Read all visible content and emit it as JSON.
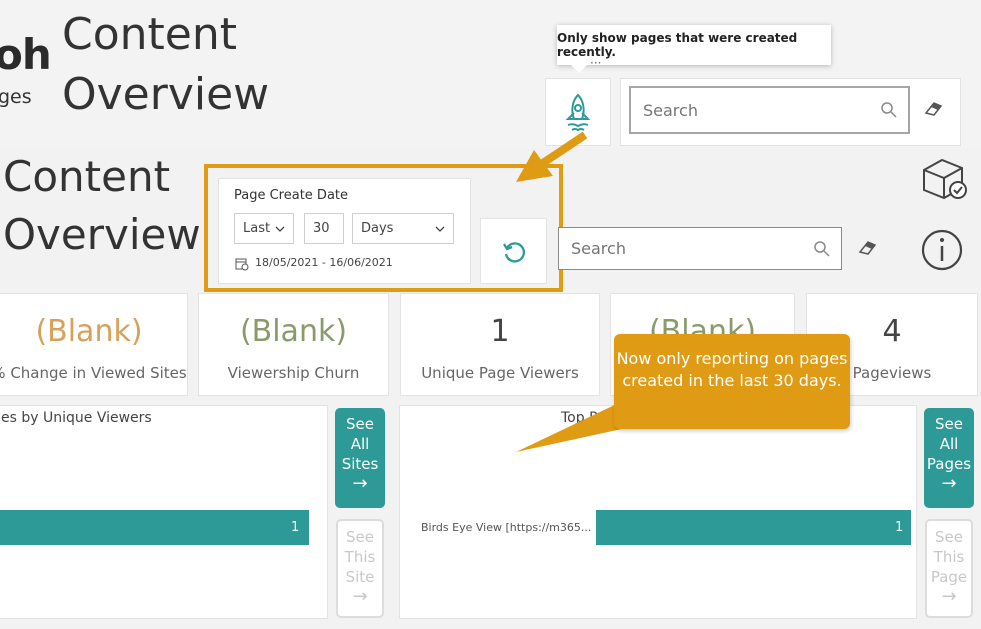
{
  "header": {
    "logo_big": "oh",
    "logo_small": "ges",
    "title_line1": "Content",
    "title_line2": "Overview",
    "tooltip": "Only show pages that were created recently.",
    "search_placeholder": "Search"
  },
  "report": {
    "title_line1": "Content",
    "title_line2": "Overview",
    "search_placeholder": "Search",
    "filter": {
      "label": "Page Create Date",
      "period": "Last",
      "count": "30",
      "unit": "Days",
      "range": "18/05/2021 - 16/06/2021"
    }
  },
  "kpis": [
    {
      "value": "(Blank)",
      "label": "% Change in Viewed Sites"
    },
    {
      "value": "(Blank)",
      "label": "Viewership Churn"
    },
    {
      "value": "1",
      "label": "Unique Page Viewers"
    },
    {
      "value": "(Blank)",
      "label": ""
    },
    {
      "value": "4",
      "label": "Pageviews"
    }
  ],
  "left_chart": {
    "title": "es by Unique Viewers",
    "bar_value": "1"
  },
  "right_chart": {
    "title": "Top P",
    "bar_label": "Birds Eye View [https://m365...",
    "bar_value": "1"
  },
  "buttons": {
    "see_all_sites": "See All Sites",
    "see_this_site": "See This Site",
    "see_all_pages": "See All Pages",
    "see_this_page": "See This Page"
  },
  "callout": "Now only reporting on pages created in the last 30 days.",
  "colors": {
    "teal": "#2e9a97",
    "orange": "#e09b14",
    "olive": "#8a9a6a",
    "blank_orange": "#d7a15c"
  }
}
